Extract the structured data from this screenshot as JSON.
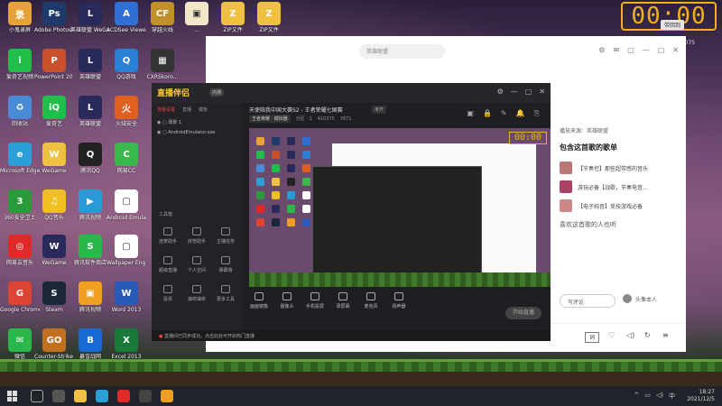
{
  "overlay": {
    "timer": "00:00",
    "badge": "带回到",
    "id_text": "8:075"
  },
  "desktop_icons": [
    {
      "label": "小鬼录屏",
      "color": "#e8a23a",
      "glyph": "录"
    },
    {
      "label": "Adobe Photosh...",
      "color": "#1d3a6b",
      "glyph": "Ps"
    },
    {
      "label": "英雄联盟 WeGame版",
      "color": "#2a2a5a",
      "glyph": "L"
    },
    {
      "label": "ACDSee Viewer",
      "color": "#2f6fd6",
      "glyph": "A"
    },
    {
      "label": "穿越火线",
      "color": "#c0902a",
      "glyph": "CF"
    },
    {
      "label": "...",
      "color": "#f2e6c8",
      "glyph": "▣"
    },
    {
      "label": "ZIP文件",
      "color": "#f0c040",
      "glyph": "Z"
    },
    {
      "label": "ZIP文件",
      "color": "#f0c040",
      "glyph": "Z"
    },
    {
      "label": "爱奇艺视频",
      "color": "#1fbf4a",
      "glyph": "i"
    },
    {
      "label": "PowerPoint 2013",
      "color": "#c8502a",
      "glyph": "P"
    },
    {
      "label": "英雄联盟",
      "color": "#2a2a5a",
      "glyph": "L"
    },
    {
      "label": "QQ游戏",
      "color": "#2a7fd6",
      "glyph": "Q"
    },
    {
      "label": "CXRSkoro...",
      "color": "#333",
      "glyph": "▦"
    },
    {
      "label": "回收站",
      "color": "#4a8ad6",
      "glyph": "♻"
    },
    {
      "label": "爱奇艺",
      "color": "#1fbf4a",
      "glyph": "iQ"
    },
    {
      "label": "英雄联盟",
      "color": "#2a2a5a",
      "glyph": "L"
    },
    {
      "label": "火绒安全",
      "color": "#e06020",
      "glyph": "火"
    },
    {
      "label": "Microsoft Edge",
      "color": "#2aa0d6",
      "glyph": "e"
    },
    {
      "label": "WeGame",
      "color": "#f0c040",
      "glyph": "W"
    },
    {
      "label": "腾讯QQ",
      "color": "#222",
      "glyph": "Q"
    },
    {
      "label": "网易CC",
      "color": "#3ab84a",
      "glyph": "C"
    },
    {
      "label": "360安全卫士",
      "color": "#2a9a3a",
      "glyph": "3"
    },
    {
      "label": "QQ音乐",
      "color": "#f0c020",
      "glyph": "♫"
    },
    {
      "label": "腾讯视频",
      "color": "#2a9ad6",
      "glyph": "▶"
    },
    {
      "label": "Android Emulator",
      "color": "#fff",
      "glyph": "▢"
    },
    {
      "label": "网易云音乐",
      "color": "#e02a2a",
      "glyph": "◎"
    },
    {
      "label": "WeGame",
      "color": "#2a2a5a",
      "glyph": "W"
    },
    {
      "label": "腾讯软件商店",
      "color": "#2ab84a",
      "glyph": "S"
    },
    {
      "label": "Wallpaper Engine",
      "color": "#fff",
      "glyph": "▢"
    },
    {
      "label": "Google Chrome",
      "color": "#dd4433",
      "glyph": "G"
    },
    {
      "label": "Steam",
      "color": "#1b2838",
      "glyph": "S"
    },
    {
      "label": "腾讯视频",
      "color": "#f0a020",
      "glyph": "▣"
    },
    {
      "label": "Word 2013",
      "color": "#2a5ab8",
      "glyph": "W"
    },
    {
      "label": "微信",
      "color": "#2ab84a",
      "glyph": "✉"
    },
    {
      "label": "Counter-Strike Global Off...",
      "color": "#c07020",
      "glyph": "GO"
    },
    {
      "label": "暴雪战网",
      "color": "#1a6ad6",
      "glyph": "B"
    },
    {
      "label": "Excel 2013",
      "color": "#1a7a3a",
      "glyph": "X"
    }
  ],
  "music": {
    "search_placeholder": "英雄联盟",
    "source": "播放来源：英雄联盟",
    "playlist_title": "包含这首歌的歌单",
    "playlists": [
      "【节奏控】那些超带感的音乐",
      "游玩必备【战歌，节奏电音...",
      "【电子纯音】竞技游戏必备"
    ],
    "likes_text": "喜欢这首歌的人也听",
    "comment_btn": "写评论",
    "user_label": "头像本人",
    "tool_icons": [
      "⚙",
      "✉",
      "▢",
      "—",
      "▢",
      "✕"
    ]
  },
  "stream": {
    "brand": "直播伴侣",
    "brand_tag": "内测",
    "room_title": "天使陪我中国大赛S2 - 王者荣耀七国赛",
    "room_status": "未开",
    "room_row": [
      "王者荣耀 · 模拟器",
      "分区 · 1",
      "410375",
      "7671"
    ],
    "tabs": [
      "场景设置",
      "直播",
      "模板"
    ],
    "scenes": [
      "场景 1",
      "AndroidEmulator.exe"
    ],
    "toolbox_label": "工具箱",
    "tools": [
      "连麦助手",
      "房管助手",
      "主播任务",
      "超级直播",
      "个人空间",
      "弹幕墙",
      "投票",
      "抽奖抽奖",
      "更多工具"
    ],
    "bottom_tools": [
      "画面镜像",
      "摄像头",
      "手机投屏",
      "录屏幕",
      "麦克风",
      "扬声器"
    ],
    "live_btn": "开始直播",
    "status_text": "直播间已同步成功，点击此处可开启热门直播",
    "preview_timer": "00:00"
  },
  "taskbar": {
    "time": "18:27",
    "date": "2021/12/5"
  }
}
